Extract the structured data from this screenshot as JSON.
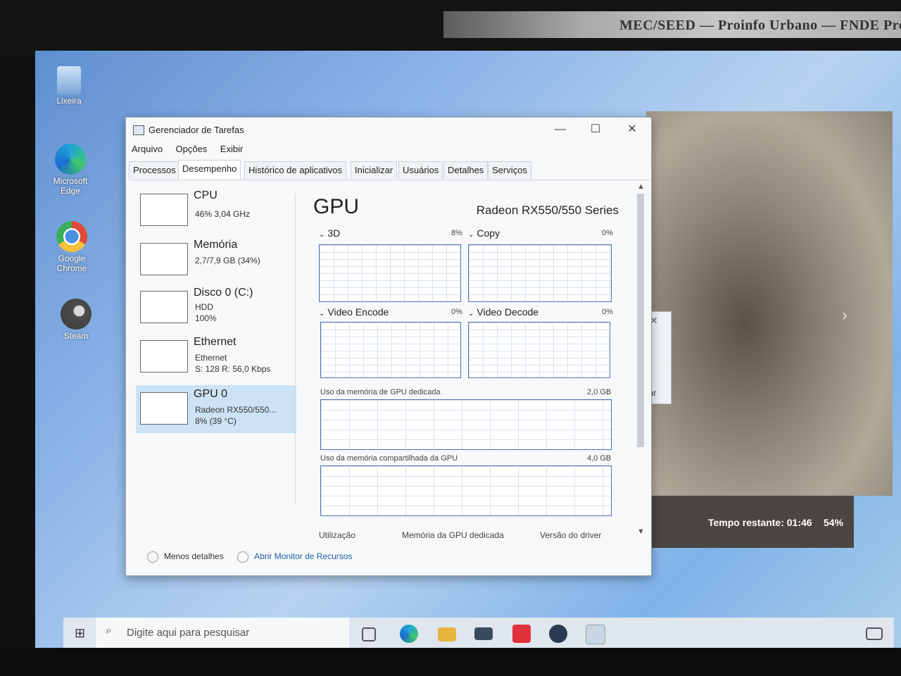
{
  "photo": {
    "label_strip_text": "MEC/SEED — Proinfo Urbano — FNDE Progr..."
  },
  "desktop": {
    "icons": [
      {
        "label": "Lixeira"
      },
      {
        "label": "Microsoft Edge"
      },
      {
        "label": "Google Chrome"
      },
      {
        "label": "Steam"
      }
    ]
  },
  "background_video": {
    "time_remaining": "Tempo restante: 01:46",
    "percent": "54%",
    "dialog_button": "lar"
  },
  "task_manager": {
    "title": "Gerenciador de Tarefas",
    "window_buttons": {
      "minimize": "—",
      "maximize": "☐",
      "close": "✕"
    },
    "menu": [
      "Arquivo",
      "Opções",
      "Exibir"
    ],
    "tabs": [
      "Processos",
      "Desempenho",
      "Histórico de aplicativos",
      "Inicializar",
      "Usuários",
      "Detalhes",
      "Serviços"
    ],
    "active_tab": "Desempenho",
    "sidebar": [
      {
        "name": "CPU",
        "line1": "46% 3,04 GHz",
        "line2": ""
      },
      {
        "name": "Memória",
        "line1": "2,7/7,9 GB (34%)",
        "line2": ""
      },
      {
        "name": "Disco 0 (C:)",
        "line1": "HDD",
        "line2": "100%"
      },
      {
        "name": "Ethernet",
        "line1": "Ethernet",
        "line2": "S: 128 R: 56,0 Kbps"
      },
      {
        "name": "GPU 0",
        "line1": "Radeon RX550/550...",
        "line2": "8% (39 °C)"
      }
    ],
    "selected_item": "GPU 0",
    "detail": {
      "title": "GPU",
      "model": "Radeon RX550/550 Series",
      "engines": [
        {
          "label": "3D",
          "percent": "8%"
        },
        {
          "label": "Copy",
          "percent": "0%"
        },
        {
          "label": "Video Encode",
          "percent": "0%"
        },
        {
          "label": "Video Decode",
          "percent": "0%"
        }
      ],
      "dedicated_label": "Uso da memória de GPU dedicada",
      "dedicated_max": "2,0 GB",
      "shared_label": "Uso da memória compartilhada da GPU",
      "shared_max": "4,0 GB",
      "footer": [
        "Utilização",
        "Memória da GPU dedicada",
        "Versão do driver"
      ]
    },
    "bottom": {
      "less_details": "Menos detalhes",
      "resource_monitor": "Abrir Monitor de Recursos"
    }
  },
  "taskbar": {
    "search_placeholder": "Digite aqui para pesquisar"
  }
}
